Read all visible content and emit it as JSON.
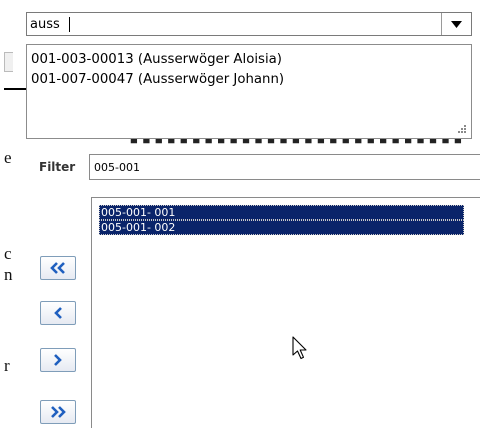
{
  "search": {
    "value": "auss"
  },
  "suggestions": [
    "001-003-00013 (Ausserwöger Aloisia)",
    "001-007-00047 (Ausserwöger Johann)"
  ],
  "filter": {
    "label": "Filter",
    "value": "005-001"
  },
  "list": {
    "items": [
      "005-001- 001",
      "005-001- 002"
    ]
  },
  "buttons": {
    "move_all_left": "«",
    "move_left": "‹",
    "move_right": "›",
    "move_all_right": "»"
  },
  "colors": {
    "selection": "#0a246a",
    "button_arrow": "#1f5fbf",
    "border": "#8a8a8a"
  }
}
